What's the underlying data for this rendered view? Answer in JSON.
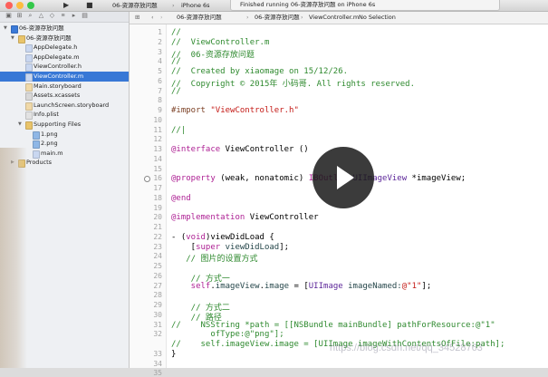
{
  "toolbar": {
    "play_glyph": "▶",
    "stop_glyph": "■",
    "scheme": "06-资源存放问题",
    "device": "iPhone 6s",
    "status": "Finished running 06-资源存放问题 on iPhone 6s",
    "colors": {
      "close": "#fc605b",
      "minimize": "#fdbc40",
      "zoom": "#34c84a"
    }
  },
  "navigator": {
    "items": [
      {
        "label": "06-资源存放问题",
        "depth": 0,
        "kind": "project",
        "expanded": true,
        "selected": false
      },
      {
        "label": "06-资源存放问题",
        "depth": 1,
        "kind": "group",
        "expanded": true,
        "selected": false
      },
      {
        "label": "AppDelegate.h",
        "depth": 2,
        "kind": "h",
        "selected": false
      },
      {
        "label": "AppDelegate.m",
        "depth": 2,
        "kind": "m",
        "selected": false
      },
      {
        "label": "ViewController.h",
        "depth": 2,
        "kind": "h",
        "selected": false
      },
      {
        "label": "ViewController.m",
        "depth": 2,
        "kind": "m",
        "selected": true
      },
      {
        "label": "Main.storyboard",
        "depth": 2,
        "kind": "storyboard",
        "selected": false
      },
      {
        "label": "Assets.xcassets",
        "depth": 2,
        "kind": "assets",
        "selected": false
      },
      {
        "label": "LaunchScreen.storyboard",
        "depth": 2,
        "kind": "storyboard",
        "selected": false
      },
      {
        "label": "Info.plist",
        "depth": 2,
        "kind": "plist",
        "selected": false
      },
      {
        "label": "Supporting Files",
        "depth": 2,
        "kind": "group",
        "expanded": true,
        "selected": false
      },
      {
        "label": "1.png",
        "depth": 3,
        "kind": "png",
        "selected": false
      },
      {
        "label": "2.png",
        "depth": 3,
        "kind": "png",
        "selected": false
      },
      {
        "label": "main.m",
        "depth": 3,
        "kind": "m",
        "selected": false
      },
      {
        "label": "Products",
        "depth": 1,
        "kind": "group",
        "expanded": false,
        "selected": false
      }
    ]
  },
  "jumpbar": {
    "crumbs": [
      "06-资源存放问题",
      "06-资源存放问题",
      "ViewController.m",
      "No Selection"
    ]
  },
  "editor": {
    "breakpoint_line": 16,
    "lines": [
      [
        [
          "//",
          "c"
        ]
      ],
      [
        [
          "//  ViewController.m",
          "c"
        ]
      ],
      [
        [
          "//  06-资源存放问题",
          "c"
        ]
      ],
      [
        [
          "//",
          "c"
        ]
      ],
      [
        [
          "//  Created by xiaomage on 15/12/26.",
          "c"
        ]
      ],
      [
        [
          "//  Copyright © 2015年 小码哥. All rights reserved.",
          "c"
        ]
      ],
      [
        [
          "//",
          "c"
        ]
      ],
      [],
      [
        [
          "#import ",
          "pp"
        ],
        [
          "\"ViewController.h\"",
          "str"
        ]
      ],
      [],
      [
        [
          "//|",
          "c"
        ]
      ],
      [],
      [
        [
          "@interface ",
          "kw"
        ],
        [
          "ViewController ()",
          ""
        ]
      ],
      [],
      [],
      [
        [
          "@property ",
          "kw"
        ],
        [
          "(weak, nonatomic) ",
          ""
        ],
        [
          "IBOutlet ",
          "kw"
        ],
        [
          "UIImageView ",
          "cls"
        ],
        [
          "*imageView;",
          ""
        ]
      ],
      [],
      [
        [
          "@end",
          "kw"
        ]
      ],
      [],
      [
        [
          "@implementation ",
          "kw"
        ],
        [
          "ViewController",
          ""
        ]
      ],
      [],
      [
        [
          "- (",
          ""
        ],
        [
          "void",
          "kw"
        ],
        [
          ")viewDidLoad {",
          ""
        ]
      ],
      [
        [
          "    [",
          ""
        ],
        [
          "super ",
          "kw"
        ],
        [
          "viewDidLoad",
          "mth"
        ],
        [
          "];",
          ""
        ]
      ],
      [
        [
          "   // 图片的设置方式",
          "c"
        ]
      ],
      [],
      [
        [
          "    // 方式一",
          "c"
        ]
      ],
      [
        [
          "    self",
          "kw"
        ],
        [
          ".",
          ""
        ],
        [
          "imageView",
          "mth"
        ],
        [
          ".",
          ""
        ],
        [
          "image",
          "mth"
        ],
        [
          " = [",
          ""
        ],
        [
          "UIImage ",
          "cls"
        ],
        [
          "imageNamed:",
          "mth"
        ],
        [
          "@\"1\"",
          "str"
        ],
        [
          "];",
          ""
        ]
      ],
      [],
      [
        [
          "    // 方式二",
          "c"
        ]
      ],
      [
        [
          "    // 路径",
          "c"
        ]
      ],
      [
        [
          "//    NSString *path = [[NSBundle mainBundle] pathForResource:@\"1\"",
          "c"
        ]
      ],
      [
        [
          "        ofType:@\"png\"];",
          "c"
        ]
      ],
      [
        [
          "//    self.imageView.image = [UIImage imageWithContentsOfFile:path];",
          "c"
        ]
      ],
      [
        [
          "}",
          ""
        ]
      ],
      [],
      [
        [
          "@end",
          "kw"
        ]
      ]
    ],
    "gutter_numbers": [
      "1",
      "2",
      "3",
      "4",
      "5",
      "6",
      "7",
      "8",
      "9",
      "10",
      "11",
      "12",
      "13",
      "14",
      "15",
      "16",
      "17",
      "18",
      "19",
      "20",
      "21",
      "22",
      "23",
      "24",
      "25",
      "26",
      "27",
      "28",
      "29",
      "30",
      "31",
      "32",
      "",
      "33",
      "34",
      "35"
    ]
  },
  "overlays": {
    "play_button": "video-play",
    "watermark": "https://blog.csdn.net/qq_34528763"
  }
}
